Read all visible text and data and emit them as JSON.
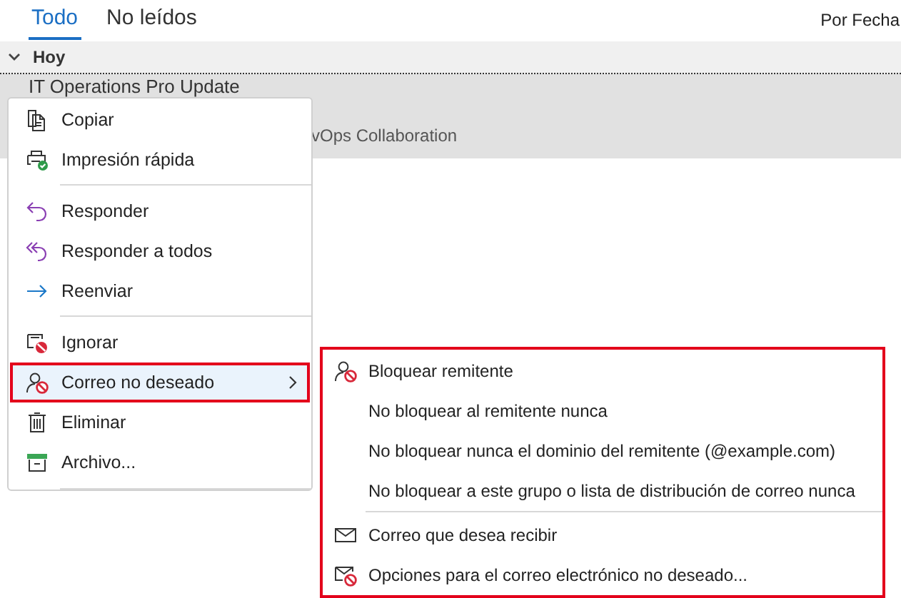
{
  "tabs": [
    {
      "label": "Todo",
      "selected": true
    },
    {
      "label": "No leídos",
      "selected": false
    }
  ],
  "sort": {
    "label": "Por Fecha"
  },
  "group": {
    "label": "Hoy",
    "expanded": true
  },
  "message": {
    "subject": "IT Operations Pro Update",
    "preview": "vOps Collaboration"
  },
  "context_menu": {
    "items": [
      {
        "kind": "item",
        "label": "Copiar",
        "selected": false
      },
      {
        "kind": "item",
        "label": "Impresión rápida",
        "selected": false
      },
      {
        "kind": "separator"
      },
      {
        "kind": "item",
        "label": "Responder",
        "selected": false
      },
      {
        "kind": "item",
        "label": "Responder a todos",
        "selected": false
      },
      {
        "kind": "item",
        "label": "Reenviar",
        "selected": false
      },
      {
        "kind": "separator"
      },
      {
        "kind": "item",
        "label": "Ignorar",
        "selected": false
      },
      {
        "kind": "submenu",
        "label": "Correo no deseado",
        "selected": true
      },
      {
        "kind": "item",
        "label": "Eliminar",
        "selected": false
      },
      {
        "kind": "item",
        "label": "Archivo...",
        "selected": false
      },
      {
        "kind": "separator"
      }
    ]
  },
  "submenu": {
    "items": [
      {
        "kind": "item",
        "label": "Bloquear remitente"
      },
      {
        "kind": "item",
        "label": "No bloquear al remitente nunca"
      },
      {
        "kind": "item",
        "label": "No bloquear nunca el dominio del remitente (@example.com)"
      },
      {
        "kind": "item",
        "label": "No bloquear a este grupo o lista de distribución de correo nunca"
      },
      {
        "kind": "separator"
      },
      {
        "kind": "item",
        "label": "Correo que desea recibir"
      },
      {
        "kind": "item",
        "label": "Opciones para el correo electrónico no deseado..."
      }
    ]
  }
}
